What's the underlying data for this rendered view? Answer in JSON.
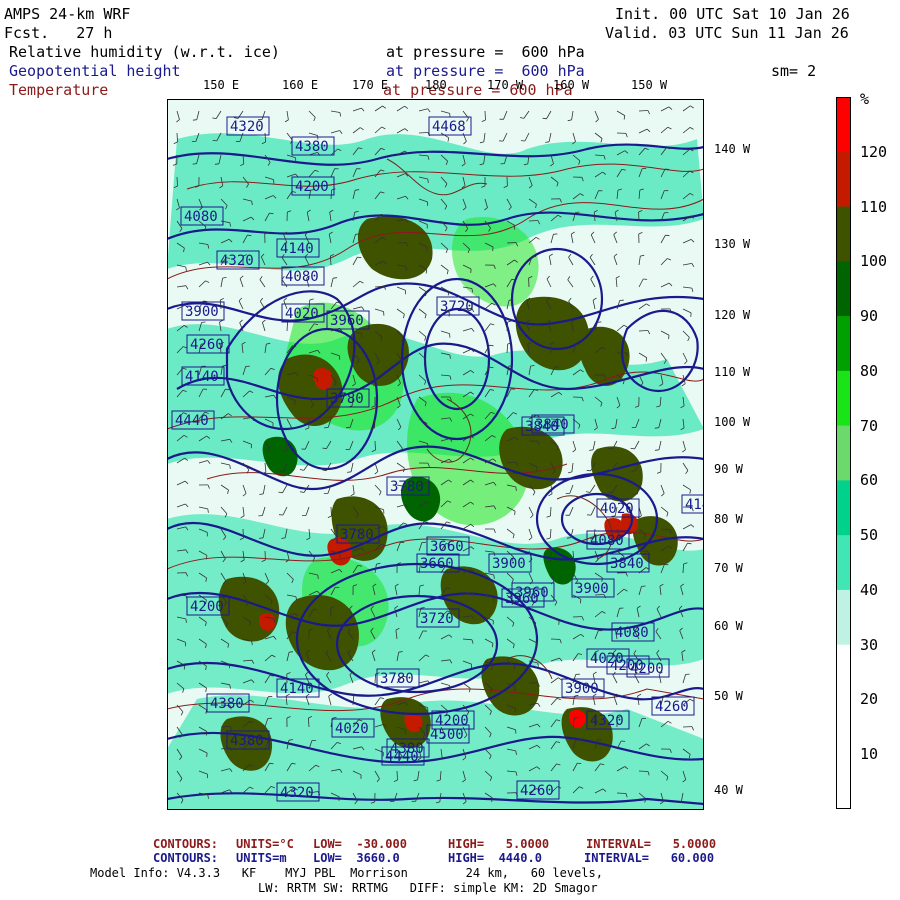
{
  "header": {
    "model": "AMPS 24-km WRF",
    "fcst": "Fcst.   27 h",
    "init": "Init. 00 UTC Sat 10 Jan 26",
    "valid": "Valid. 03 UTC Sun 11 Jan 26",
    "fields": [
      {
        "name": "Relative humidity (w.r.t. ice)",
        "level": "at pressure =  600 hPa",
        "color": "#000000"
      },
      {
        "name": "Geopotential height",
        "level": "at pressure =  600 hPa",
        "color": "#1a1a8c"
      },
      {
        "name": "Temperature",
        "level": "at pressure = 600 hPa",
        "color": "#8b1a1a"
      }
    ],
    "smoothing": "sm= 2"
  },
  "longitude_labels": [
    "150 E",
    "160 E",
    "170 E",
    "180",
    "170 W",
    "160 W",
    "150 W"
  ],
  "latitude_labels": [
    "140 W",
    "130 W",
    "120 W",
    "110 W",
    "100 W",
    "90 W",
    "80 W",
    "70 W",
    "60 W",
    "50 W",
    "40 W"
  ],
  "colorbar": {
    "unit": "%",
    "ticks": [
      "120",
      "110",
      "100",
      "90",
      "80",
      "70",
      "60",
      "50",
      "40",
      "30",
      "20",
      "10"
    ],
    "colors": [
      "#ff0000",
      "#c41a00",
      "#3e5200",
      "#006400",
      "#00a000",
      "#18e418",
      "#6cd96c",
      "#00d28c",
      "#40e6b4",
      "#bff2e2",
      "#ffffff",
      "#ffffff",
      "#ffffff"
    ]
  },
  "height_labels": [
    "4320",
    "4468",
    "4380",
    "4200",
    "4080",
    "4320",
    "4140",
    "4080",
    "4020",
    "3960",
    "3720",
    "3900",
    "4260",
    "4140",
    "4440",
    "3780",
    "3780",
    "3660",
    "3900",
    "3960",
    "3840",
    "3720",
    "3780",
    "3900",
    "3960",
    "4080",
    "4200",
    "4380",
    "4140",
    "4320",
    "4380",
    "4440",
    "4020",
    "4200",
    "4260",
    "4320",
    "3840",
    "3900",
    "4020",
    "4140",
    "4260",
    "4200",
    "4380",
    "4020",
    "4080",
    "4200",
    "3780",
    "3660",
    "4500",
    "3840"
  ],
  "footer": {
    "temp": {
      "label": "CONTOURS:",
      "units": "UNITS=°C",
      "low": "LOW=  -30.000",
      "high": "HIGH=   5.0000",
      "interval": "INTERVAL=   5.0000"
    },
    "height": {
      "label": "CONTOURS:",
      "units": "UNITS=m",
      "low": "LOW=  3660.0",
      "high": "HIGH=  4440.0",
      "interval": "INTERVAL=   60.000"
    },
    "model_info": "Model Info: V4.3.3   KF    MYJ PBL  Morrison        24 km,   60 levels,",
    "physics": "LW: RRTM SW: RRTMG   DIFF: simple KM: 2D Smagor"
  }
}
